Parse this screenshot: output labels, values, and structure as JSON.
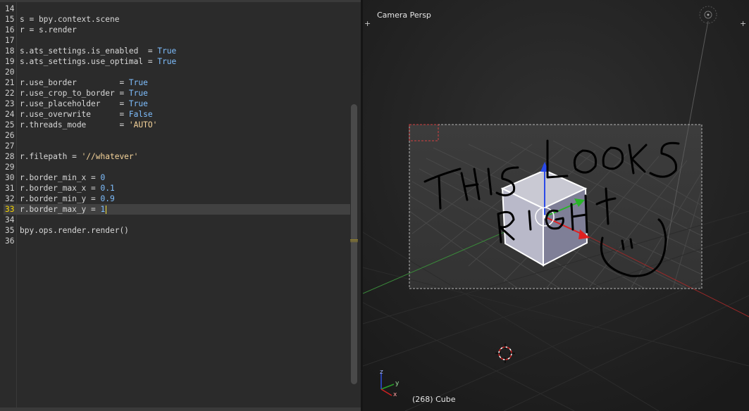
{
  "editor": {
    "current_line": 33,
    "lines": [
      {
        "n": "14",
        "t": ""
      },
      {
        "n": "15",
        "t": "s = bpy.context.scene"
      },
      {
        "n": "16",
        "t": "r = s.render"
      },
      {
        "n": "17",
        "t": ""
      },
      {
        "n": "18",
        "t": "s.ats_settings.is_enabled  = ",
        "v": "True",
        "vt": "kw"
      },
      {
        "n": "19",
        "t": "s.ats_settings.use_optimal = ",
        "v": "True",
        "vt": "kw"
      },
      {
        "n": "20",
        "t": ""
      },
      {
        "n": "21",
        "t": "r.use_border         = ",
        "v": "True",
        "vt": "kw"
      },
      {
        "n": "22",
        "t": "r.use_crop_to_border = ",
        "v": "True",
        "vt": "kw"
      },
      {
        "n": "23",
        "t": "r.use_placeholder    = ",
        "v": "True",
        "vt": "kw"
      },
      {
        "n": "24",
        "t": "r.use_overwrite      = ",
        "v": "False",
        "vt": "kw"
      },
      {
        "n": "25",
        "t": "r.threads_mode       = ",
        "v": "'AUTO'",
        "vt": "str"
      },
      {
        "n": "26",
        "t": ""
      },
      {
        "n": "27",
        "t": ""
      },
      {
        "n": "28",
        "t": "r.filepath = ",
        "v": "'//whatever'",
        "vt": "str"
      },
      {
        "n": "29",
        "t": ""
      },
      {
        "n": "30",
        "t": "r.border_min_x = ",
        "v": "0",
        "vt": "numv"
      },
      {
        "n": "31",
        "t": "r.border_max_x = ",
        "v": "0.1",
        "vt": "numv"
      },
      {
        "n": "32",
        "t": "r.border_min_y = ",
        "v": "0.9",
        "vt": "numv"
      },
      {
        "n": "33",
        "t": "r.border_max_y = ",
        "v": "1",
        "vt": "numv"
      },
      {
        "n": "34",
        "t": ""
      },
      {
        "n": "35",
        "t": "bpy.ops.render.render()"
      },
      {
        "n": "36",
        "t": ""
      }
    ]
  },
  "viewport": {
    "title": "Camera Persp",
    "status": "(268) Cube",
    "corner_plus": "+",
    "handwriting": "THIS LOOKS RIGHT :)",
    "gizmo_axes": [
      "z",
      "y",
      "x"
    ]
  },
  "colors": {
    "keyword": "#7fbfff",
    "string": "#f5d39a",
    "current_line_number": "#f5d400",
    "axis_x": "#c83030",
    "axis_y": "#3a9a3a",
    "axis_z": "#3050e0",
    "selection_outline": "#ffffff"
  }
}
